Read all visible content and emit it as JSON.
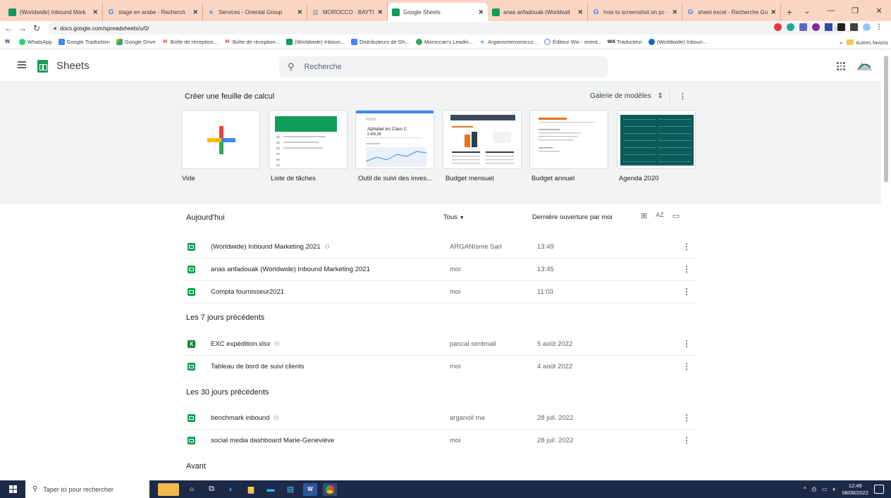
{
  "browser": {
    "tabs": [
      {
        "title": "(Worldwide) Inbound Mark",
        "favicon": "sheets"
      },
      {
        "title": "stage en arabe - Recherch",
        "favicon": "google"
      },
      {
        "title": "Services - Oriental Group",
        "favicon": "wix"
      },
      {
        "title": "MOROCCO - BAYTI: UNESC",
        "favicon": "doc"
      },
      {
        "title": "Google Sheets",
        "favicon": "sheets",
        "active": true
      },
      {
        "title": "anas anfadouak (Worldwid",
        "favicon": "sheets"
      },
      {
        "title": "how to screenshot on pc -",
        "favicon": "google"
      },
      {
        "title": "sheet excel - Recherche Go",
        "favicon": "google"
      }
    ],
    "url": "docs.google.com/spreadsheets/u/0/",
    "bookmarks": [
      "WhatsApp",
      "Google Traduction",
      "Google Drive",
      "Boîte de réception...",
      "Boîte de réception...",
      "(Worldwide) Inboun...",
      "Distributeurs de Gh...",
      "Moroccan's Leadin...",
      "Arganismemorocco...",
      "Éditeur Wix - orient...",
      "Traducteur",
      "(Worldwide) Inboun..."
    ],
    "other_bookmarks": "Autres favoris"
  },
  "app": {
    "name": "Sheets",
    "search_placeholder": "Recherche"
  },
  "gallery": {
    "title": "Créer une feuille de calcul",
    "models_label": "Galerie de modèles",
    "templates": [
      {
        "label": "Vide"
      },
      {
        "label": "Liste de tâches"
      },
      {
        "label": "Outil de suivi des inves..."
      },
      {
        "label": "Budget mensuel"
      },
      {
        "label": "Budget annuel"
      },
      {
        "label": "Agenda 2020"
      }
    ],
    "thumb_text": {
      "alphabet": "Alphabet Inc Class C",
      "alphabet_value": "2 409,28"
    }
  },
  "list": {
    "filter_owner": "Tous",
    "sort_label": "Dernière ouverture par moi",
    "sections": [
      {
        "title": "Aujourd'hui",
        "files": [
          {
            "name": "(Worldwide) Inbound Marketing 2021",
            "shared": true,
            "owner": "ARGANIsme Sarl",
            "opened": "13:49",
            "type": "sheets"
          },
          {
            "name": "anas anfadouak (Worldwide) Inbound Marketing 2021",
            "shared": false,
            "owner": "moi",
            "opened": "13:45",
            "type": "sheets"
          },
          {
            "name": "Compta fournisseur2021",
            "shared": false,
            "owner": "moi",
            "opened": "11:03",
            "type": "sheets"
          }
        ]
      },
      {
        "title": "Les 7 jours précédents",
        "files": [
          {
            "name": "EXC expédition.xlsx",
            "shared": true,
            "owner": "pascal sentmail",
            "opened": "5 août 2022",
            "type": "xlsx"
          },
          {
            "name": "Tableau de bord de suivi clients",
            "shared": false,
            "owner": "moi",
            "opened": "4 août 2022",
            "type": "sheets"
          }
        ]
      },
      {
        "title": "Les 30 jours précédents",
        "files": [
          {
            "name": "benchmark inbound",
            "shared": true,
            "owner": "arganoil ma",
            "opened": "28 juil. 2022",
            "type": "sheets"
          },
          {
            "name": "social media dashboard Marie-Geneviève",
            "shared": false,
            "owner": "moi",
            "opened": "28 juil. 2022",
            "type": "sheets"
          }
        ]
      },
      {
        "title": "Avant",
        "files": []
      }
    ]
  },
  "taskbar": {
    "search_placeholder": "Taper ici pour rechercher",
    "time": "12:49",
    "date": "08/08/2022"
  },
  "colors": {
    "sheets_green": "#0f9d58",
    "tabstrip": "#f9d6c4",
    "gallery_bg": "#f1f3f4",
    "taskbar": "#1c2a47"
  }
}
